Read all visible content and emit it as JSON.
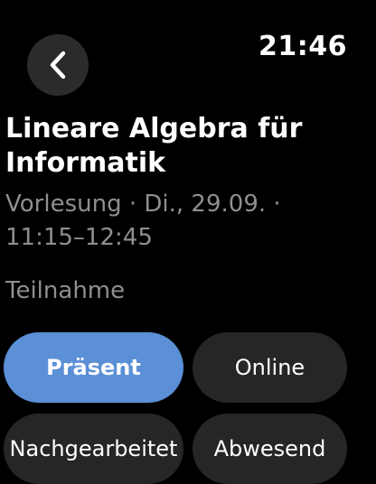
{
  "status_bar": {
    "time": "21:46"
  },
  "nav": {
    "back_icon": "chevron-left-icon"
  },
  "event": {
    "title": "Lineare Algebra für Informatik",
    "subtitle": "Vorlesung · Di., 29.09. · 11:15–12:45"
  },
  "attendance": {
    "label": "Teilnahme",
    "options": [
      {
        "label": "Präsent",
        "selected": true
      },
      {
        "label": "Online",
        "selected": false
      },
      {
        "label": "Nachgearbeitet",
        "selected": false
      },
      {
        "label": "Abwesend",
        "selected": false
      }
    ]
  },
  "colors": {
    "background": "#000000",
    "accent": "#5b8fd6",
    "secondary_text": "#8e8e93",
    "button_background": "#262626"
  }
}
